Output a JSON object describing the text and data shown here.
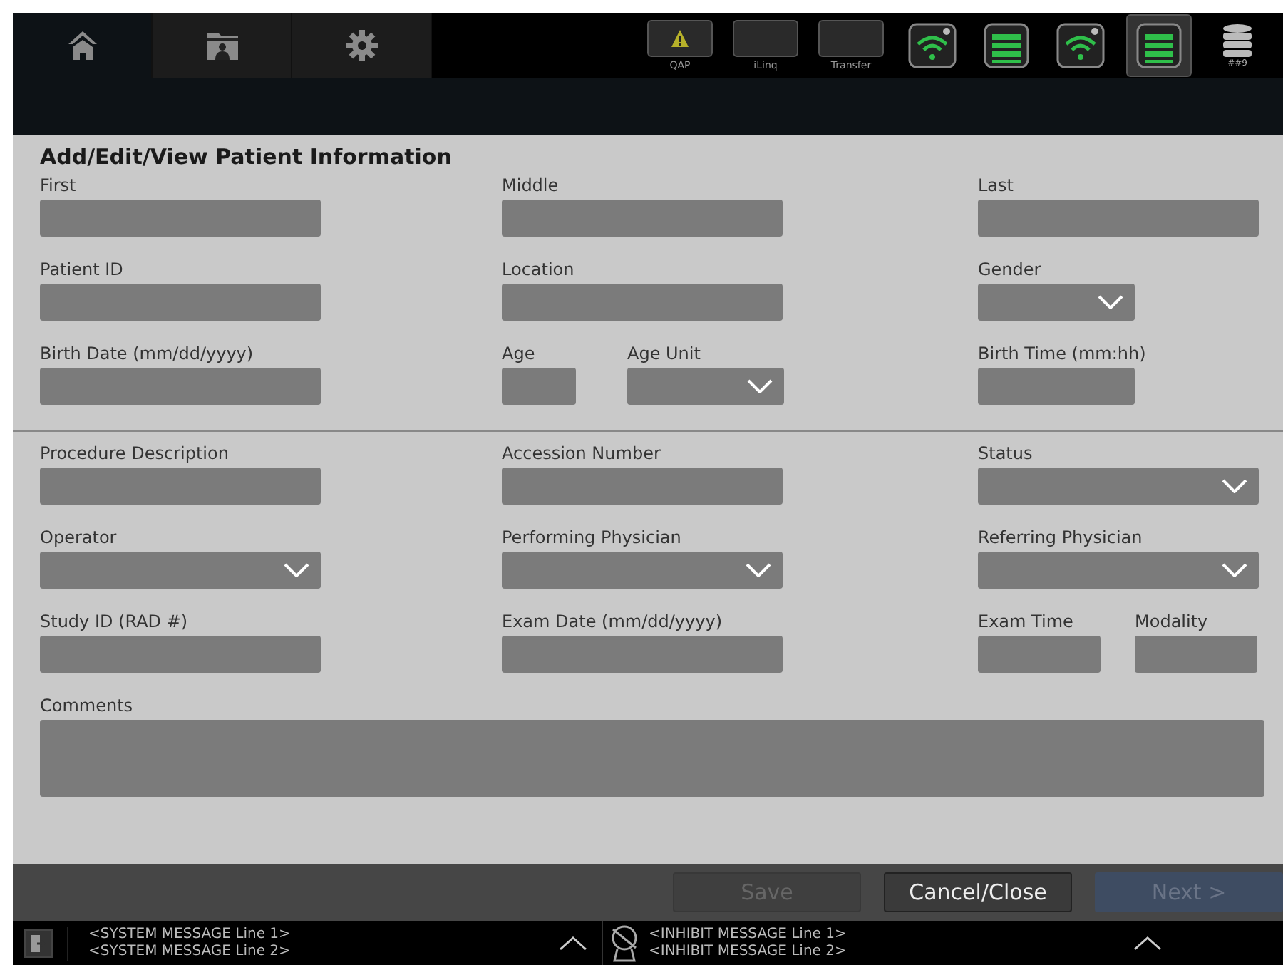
{
  "nav_tabs": [
    {
      "kind": "home",
      "selected": true
    },
    {
      "kind": "folder",
      "selected": false
    },
    {
      "kind": "settings",
      "selected": false
    }
  ],
  "status_buttons": [
    {
      "kind": "warning",
      "label": "QAP"
    },
    {
      "kind": "blank",
      "label": "iLinq"
    },
    {
      "kind": "blank",
      "label": "Transfer"
    }
  ],
  "status_icons": [
    {
      "kind": "wifi",
      "selected": false
    },
    {
      "kind": "battery",
      "selected": false
    },
    {
      "kind": "wifi",
      "selected": false
    },
    {
      "kind": "battery",
      "selected": true
    },
    {
      "kind": "disk",
      "selected": false,
      "label": "##9"
    }
  ],
  "title": "Add/Edit/View Patient Information",
  "sections": [
    {
      "rows": [
        [
          [
            {
              "label": "First",
              "kind": "text"
            }
          ],
          [
            {
              "label": "Middle",
              "kind": "text"
            }
          ],
          [
            {
              "label": "Last",
              "kind": "text"
            }
          ]
        ],
        [
          [
            {
              "label": "Patient ID",
              "kind": "text"
            }
          ],
          [
            {
              "label": "Location",
              "kind": "text"
            }
          ],
          [
            {
              "label": "Gender",
              "kind": "short-dropdown"
            }
          ]
        ],
        [
          [
            {
              "label": "Birth Date (mm/dd/yyyy)",
              "kind": "text"
            }
          ],
          [
            {
              "label": "Age",
              "kind": "tiny-text"
            },
            {
              "label": "Age Unit",
              "kind": "short-dropdown"
            }
          ],
          [
            {
              "label": "Birth Time (mm:hh)",
              "kind": "short-text"
            }
          ]
        ]
      ]
    },
    {
      "rows": [
        [
          [
            {
              "label": "Procedure Description",
              "kind": "text"
            }
          ],
          [
            {
              "label": "Accession Number",
              "kind": "text"
            }
          ],
          [
            {
              "label": "Status",
              "kind": "dropdown"
            }
          ]
        ],
        [
          [
            {
              "label": "Operator",
              "kind": "dropdown"
            }
          ],
          [
            {
              "label": "Performing Physician",
              "kind": "dropdown"
            }
          ],
          [
            {
              "label": "Referring Physician",
              "kind": "dropdown"
            }
          ]
        ],
        [
          [
            {
              "label": "Study ID (RAD #)",
              "kind": "text"
            }
          ],
          [
            {
              "label": "Exam Date (mm/dd/yyyy)",
              "kind": "text"
            }
          ],
          [
            {
              "label": "Exam Time",
              "kind": "half-text"
            },
            {
              "label": "Modality",
              "kind": "half-text"
            }
          ]
        ]
      ]
    }
  ],
  "comments": {
    "label": "Comments"
  },
  "actions": [
    {
      "label": "Save",
      "kind": "plain",
      "disabled": true
    },
    {
      "label": "Cancel/Close",
      "kind": "plain",
      "disabled": false
    },
    {
      "label": "Next >",
      "kind": "primary",
      "disabled": true
    }
  ],
  "system_messages": [
    "<SYSTEM MESSAGE Line 1>",
    "<SYSTEM MESSAGE Line 2>"
  ],
  "inhibit_messages": [
    "<INHIBIT MESSAGE Line 1>",
    "<INHIBIT MESSAGE Line 2>"
  ]
}
